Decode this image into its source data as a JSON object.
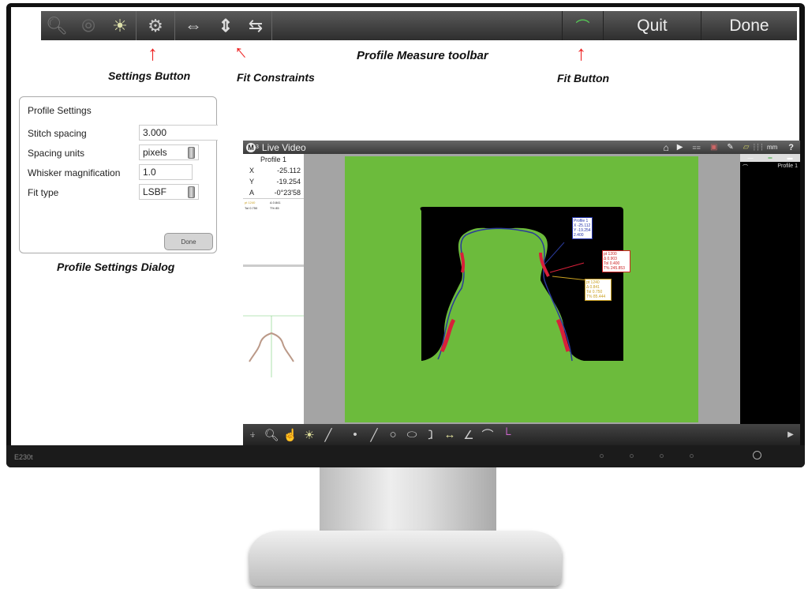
{
  "toolbar": {
    "icons": [
      "zoom-icon",
      "fit-view-icon",
      "light-icon",
      "settings-icon",
      "horizontal-constraint-icon",
      "vertical-constraint-icon",
      "flip-constraint-icon",
      "fit-icon"
    ],
    "quit_label": "Quit",
    "done_label": "Done"
  },
  "annotations": {
    "settings": "Settings Button",
    "constraints": "Fit Constraints",
    "toolbar": "Profile Measure toolbar",
    "fit": "Fit Button",
    "dialog": "Profile Settings Dialog"
  },
  "dialog": {
    "title": "Profile Settings",
    "fields": [
      {
        "label": "Stitch spacing",
        "value": "3.000"
      },
      {
        "label": "Spacing units",
        "value": "pixels"
      },
      {
        "label": "Whisker magnification",
        "value": "1.0"
      },
      {
        "label": "Fit type",
        "value": "LSBF"
      }
    ],
    "done_label": "Done"
  },
  "live_video": {
    "logo": "M",
    "logo_sup": "3",
    "title": "Live Video",
    "units": "mm",
    "help": "?",
    "info": {
      "title": "Profile 1",
      "rows": [
        {
          "label": "X",
          "value": "-25.112"
        },
        {
          "label": "Y",
          "value": "-19.254"
        },
        {
          "label": "A",
          "value": "-0°23'58"
        }
      ],
      "small": [
        "pt 1240",
        "Δ 0.841",
        "Tol 0.750",
        "T% 85"
      ]
    },
    "feature_list": [
      {
        "name": "Profile 1"
      }
    ],
    "tags": [
      {
        "lines": [
          "Profile 1",
          "X -25.112",
          "Y -19.254",
          "2.400"
        ],
        "color": "#2233aa"
      },
      {
        "lines": [
          "pt 1200",
          "Δ 0.903",
          "Tol 0.400",
          "T% 245.853"
        ],
        "color": "#cc2222"
      },
      {
        "lines": [
          "pt 1240",
          "Δ 0.841",
          "Tol 0.750",
          "T% 85.444"
        ],
        "color": "#c9a020"
      }
    ],
    "colors": {
      "background": "#6cbb3c",
      "part": "#000000",
      "out_of_tol": "#d8203a"
    }
  },
  "monitor": {
    "model": "E230t"
  }
}
